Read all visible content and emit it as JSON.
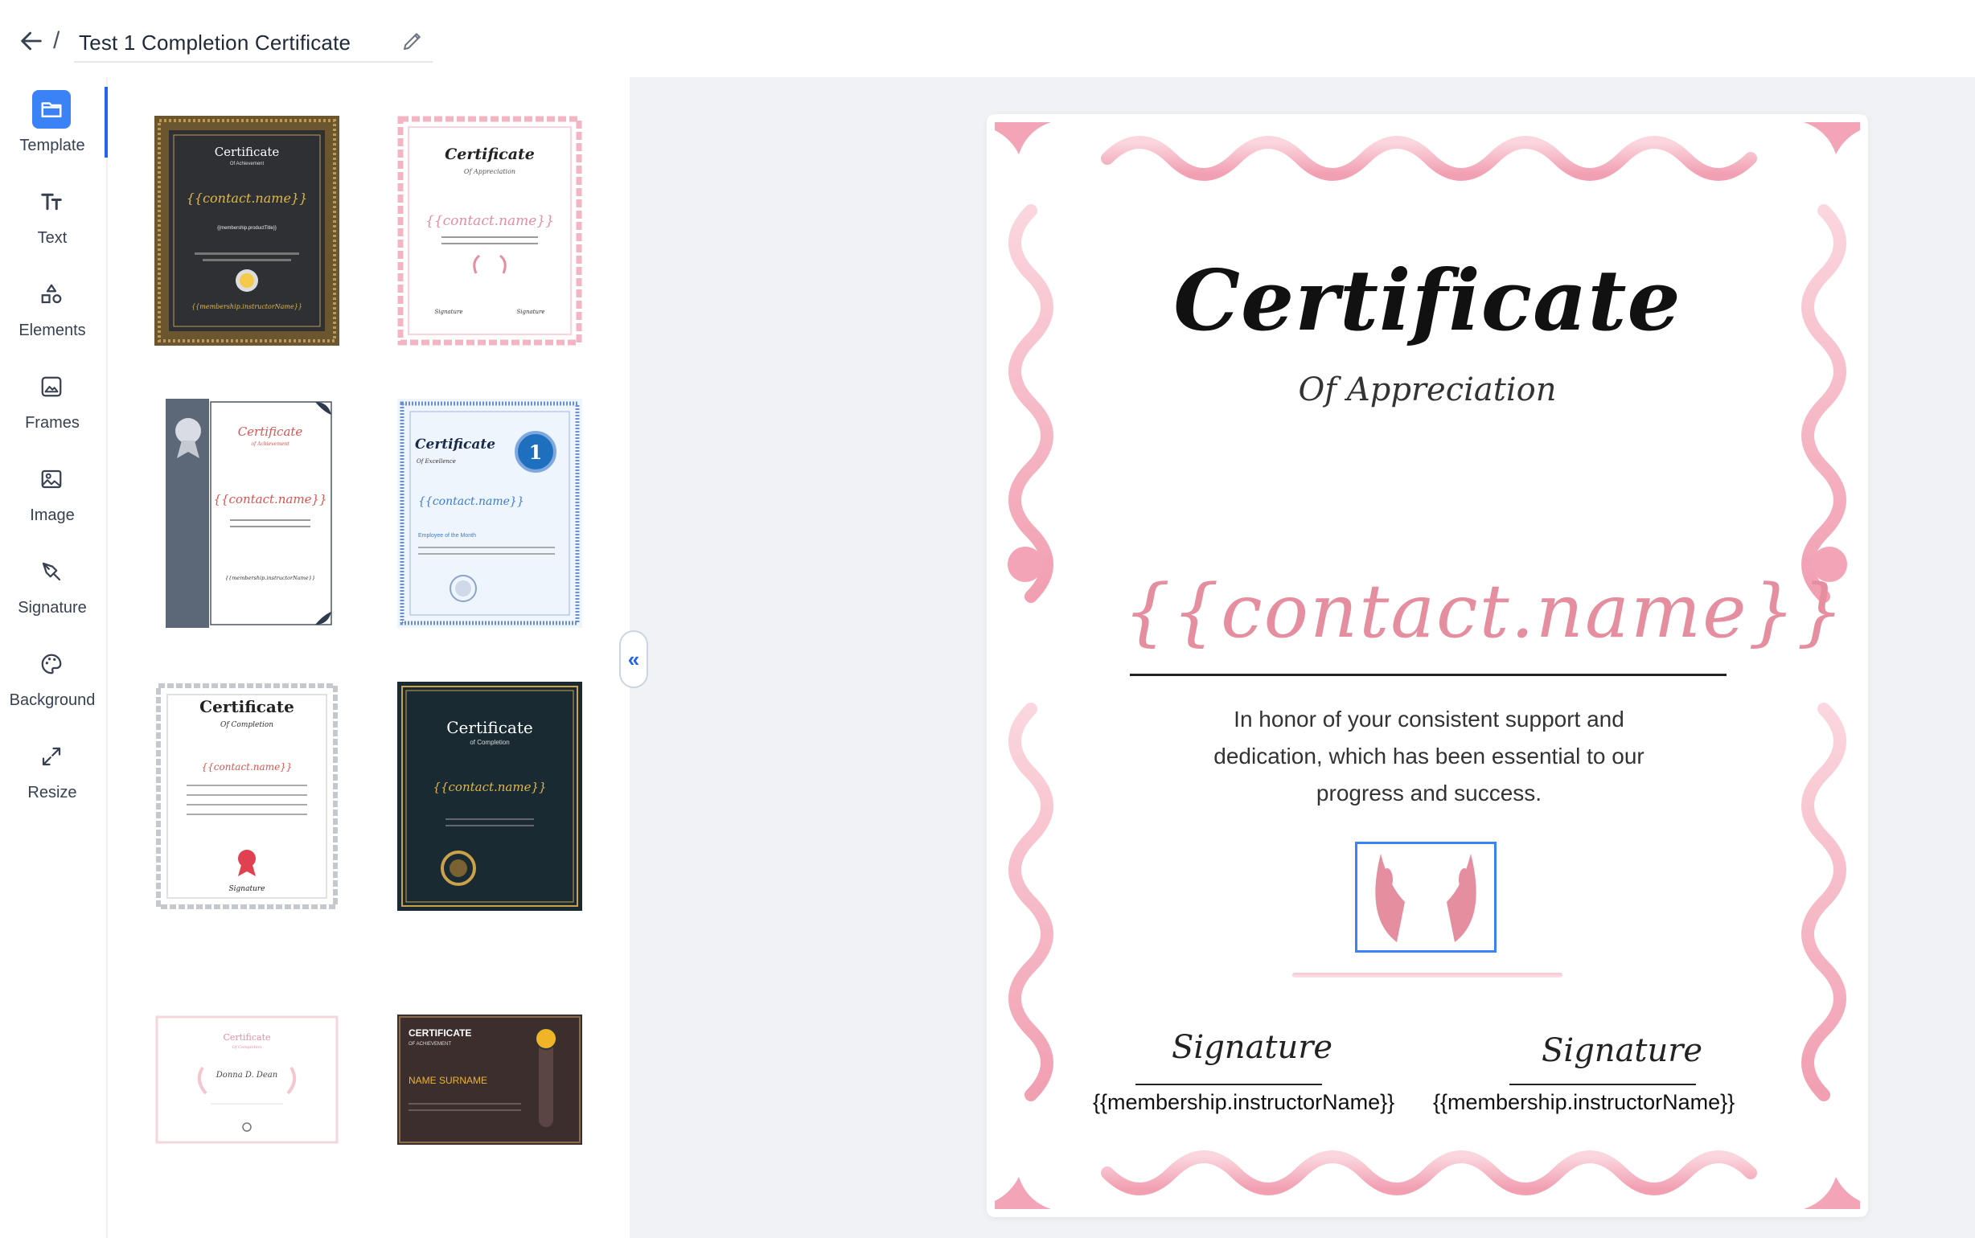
{
  "header": {
    "title": "Test 1 Completion Certificate",
    "separator": "/"
  },
  "sidebar": {
    "items": [
      {
        "label": "Template",
        "icon": "folder-icon",
        "active": true
      },
      {
        "label": "Text",
        "icon": "text-size-icon"
      },
      {
        "label": "Elements",
        "icon": "shapes-icon"
      },
      {
        "label": "Frames",
        "icon": "frame-icon"
      },
      {
        "label": "Image",
        "icon": "image-icon"
      },
      {
        "label": "Signature",
        "icon": "pen-icon"
      },
      {
        "label": "Background",
        "icon": "palette-icon"
      },
      {
        "label": "Resize",
        "icon": "resize-icon"
      }
    ]
  },
  "templates": [
    {
      "title": "Certificate",
      "subtitle": "Of Achievement",
      "name": "{{contact.name}}",
      "field": "{{membership.productTitle}}",
      "signer": "{{membership.instructorName}}"
    },
    {
      "title": "Certificate",
      "subtitle": "Of Appreciation",
      "name": "{{contact.name}}",
      "sig": "Signature"
    },
    {
      "title": "Certificate",
      "subtitle": "of Achievement",
      "name": "{{contact.name}}",
      "signer": "{{membership.instructorName}}"
    },
    {
      "title": "Certificate",
      "subtitle": "Of Excellence",
      "name": "{{contact.name}}",
      "badge": "1",
      "line": "Employee of the Month"
    },
    {
      "title": "Certificate",
      "subtitle": "Of Completion",
      "name": "{{contact.name}}",
      "sig": "Signature"
    },
    {
      "title": "Certificate",
      "subtitle": "of Completion",
      "name": "{{contact.name}}"
    },
    {
      "title": "Certificate",
      "subtitle": "Of Completion",
      "name": "Donna D. Dean"
    },
    {
      "title": "CERTIFICATE",
      "subtitle": "OF ACHIEVEMENT",
      "name": "NAME SURNAME"
    }
  ],
  "canvas": {
    "collapse_label": "«",
    "certificate": {
      "title": "Certificate",
      "subtitle": "Of Appreciation",
      "name": "{{contact.name}}",
      "body": "In honor of your consistent support and dedication, which has been essential to our progress and success.",
      "signatures": [
        {
          "script": "Signature",
          "name": "{{membership.instructorName}}"
        },
        {
          "script": "Signature",
          "name": "{{membership.instructorName}}"
        }
      ]
    }
  },
  "colors": {
    "accent": "#3b82f6",
    "frame_pink": "#f4a9b8",
    "name_pink": "#e58ea0",
    "canvas_bg": "#f0f2f5"
  }
}
